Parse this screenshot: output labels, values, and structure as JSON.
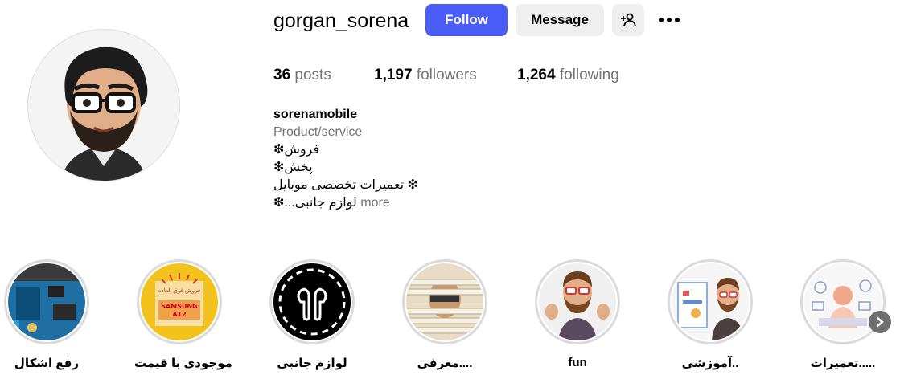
{
  "profile": {
    "username": "gorgan_sorena",
    "follow_label": "Follow",
    "message_label": "Message",
    "stats": {
      "posts_count": "36",
      "posts_label": "posts",
      "followers_count": "1,197",
      "followers_label": "followers",
      "following_count": "1,264",
      "following_label": "following"
    },
    "bio": {
      "name": "sorenamobile",
      "category": "Product/service",
      "line1": "❇فروش",
      "line2": "❇پخش",
      "line3": "تعمیرات تخصصی موبایل ❇",
      "line4": "❇...لوازم جانبی",
      "more_label": "more"
    }
  },
  "highlights": [
    {
      "label": "رفع اشکال",
      "icon": "circuit-board-image"
    },
    {
      "label": "موجودی با قیمت",
      "icon": "samsung-a12-image"
    },
    {
      "label": "لوازم جانبی",
      "icon": "earbuds-image"
    },
    {
      "label": "معرفی....",
      "icon": "blinds-man-image"
    },
    {
      "label": "fun",
      "icon": "thumbs-up-avatar-image"
    },
    {
      "label": "آموزشی..",
      "icon": "presentation-avatar-image"
    },
    {
      "label": "تعمیرات.....",
      "icon": "repair-illustration-image"
    }
  ],
  "colors": {
    "follow_bg": "#4a5df9",
    "secondary_bg": "#efefef",
    "muted_text": "#737373"
  }
}
